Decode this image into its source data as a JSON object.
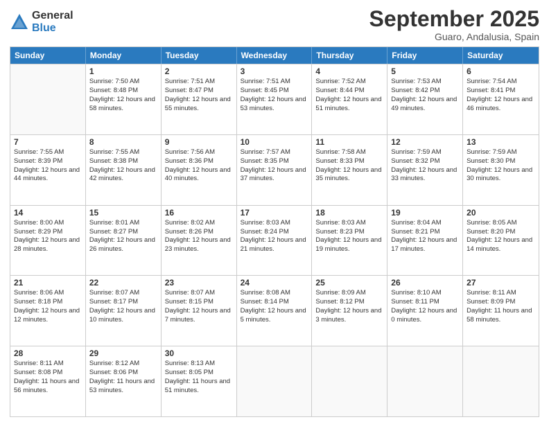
{
  "logo": {
    "general": "General",
    "blue": "Blue"
  },
  "title": "September 2025",
  "location": "Guaro, Andalusia, Spain",
  "weekdays": [
    "Sunday",
    "Monday",
    "Tuesday",
    "Wednesday",
    "Thursday",
    "Friday",
    "Saturday"
  ],
  "weeks": [
    [
      {
        "day": null
      },
      {
        "day": "1",
        "sunrise": "7:50 AM",
        "sunset": "8:48 PM",
        "daylight": "12 hours and 58 minutes."
      },
      {
        "day": "2",
        "sunrise": "7:51 AM",
        "sunset": "8:47 PM",
        "daylight": "12 hours and 55 minutes."
      },
      {
        "day": "3",
        "sunrise": "7:51 AM",
        "sunset": "8:45 PM",
        "daylight": "12 hours and 53 minutes."
      },
      {
        "day": "4",
        "sunrise": "7:52 AM",
        "sunset": "8:44 PM",
        "daylight": "12 hours and 51 minutes."
      },
      {
        "day": "5",
        "sunrise": "7:53 AM",
        "sunset": "8:42 PM",
        "daylight": "12 hours and 49 minutes."
      },
      {
        "day": "6",
        "sunrise": "7:54 AM",
        "sunset": "8:41 PM",
        "daylight": "12 hours and 46 minutes."
      }
    ],
    [
      {
        "day": "7",
        "sunrise": "7:55 AM",
        "sunset": "8:39 PM",
        "daylight": "12 hours and 44 minutes."
      },
      {
        "day": "8",
        "sunrise": "7:55 AM",
        "sunset": "8:38 PM",
        "daylight": "12 hours and 42 minutes."
      },
      {
        "day": "9",
        "sunrise": "7:56 AM",
        "sunset": "8:36 PM",
        "daylight": "12 hours and 40 minutes."
      },
      {
        "day": "10",
        "sunrise": "7:57 AM",
        "sunset": "8:35 PM",
        "daylight": "12 hours and 37 minutes."
      },
      {
        "day": "11",
        "sunrise": "7:58 AM",
        "sunset": "8:33 PM",
        "daylight": "12 hours and 35 minutes."
      },
      {
        "day": "12",
        "sunrise": "7:59 AM",
        "sunset": "8:32 PM",
        "daylight": "12 hours and 33 minutes."
      },
      {
        "day": "13",
        "sunrise": "7:59 AM",
        "sunset": "8:30 PM",
        "daylight": "12 hours and 30 minutes."
      }
    ],
    [
      {
        "day": "14",
        "sunrise": "8:00 AM",
        "sunset": "8:29 PM",
        "daylight": "12 hours and 28 minutes."
      },
      {
        "day": "15",
        "sunrise": "8:01 AM",
        "sunset": "8:27 PM",
        "daylight": "12 hours and 26 minutes."
      },
      {
        "day": "16",
        "sunrise": "8:02 AM",
        "sunset": "8:26 PM",
        "daylight": "12 hours and 23 minutes."
      },
      {
        "day": "17",
        "sunrise": "8:03 AM",
        "sunset": "8:24 PM",
        "daylight": "12 hours and 21 minutes."
      },
      {
        "day": "18",
        "sunrise": "8:03 AM",
        "sunset": "8:23 PM",
        "daylight": "12 hours and 19 minutes."
      },
      {
        "day": "19",
        "sunrise": "8:04 AM",
        "sunset": "8:21 PM",
        "daylight": "12 hours and 17 minutes."
      },
      {
        "day": "20",
        "sunrise": "8:05 AM",
        "sunset": "8:20 PM",
        "daylight": "12 hours and 14 minutes."
      }
    ],
    [
      {
        "day": "21",
        "sunrise": "8:06 AM",
        "sunset": "8:18 PM",
        "daylight": "12 hours and 12 minutes."
      },
      {
        "day": "22",
        "sunrise": "8:07 AM",
        "sunset": "8:17 PM",
        "daylight": "12 hours and 10 minutes."
      },
      {
        "day": "23",
        "sunrise": "8:07 AM",
        "sunset": "8:15 PM",
        "daylight": "12 hours and 7 minutes."
      },
      {
        "day": "24",
        "sunrise": "8:08 AM",
        "sunset": "8:14 PM",
        "daylight": "12 hours and 5 minutes."
      },
      {
        "day": "25",
        "sunrise": "8:09 AM",
        "sunset": "8:12 PM",
        "daylight": "12 hours and 3 minutes."
      },
      {
        "day": "26",
        "sunrise": "8:10 AM",
        "sunset": "8:11 PM",
        "daylight": "12 hours and 0 minutes."
      },
      {
        "day": "27",
        "sunrise": "8:11 AM",
        "sunset": "8:09 PM",
        "daylight": "11 hours and 58 minutes."
      }
    ],
    [
      {
        "day": "28",
        "sunrise": "8:11 AM",
        "sunset": "8:08 PM",
        "daylight": "11 hours and 56 minutes."
      },
      {
        "day": "29",
        "sunrise": "8:12 AM",
        "sunset": "8:06 PM",
        "daylight": "11 hours and 53 minutes."
      },
      {
        "day": "30",
        "sunrise": "8:13 AM",
        "sunset": "8:05 PM",
        "daylight": "11 hours and 51 minutes."
      },
      {
        "day": null
      },
      {
        "day": null
      },
      {
        "day": null
      },
      {
        "day": null
      }
    ]
  ]
}
